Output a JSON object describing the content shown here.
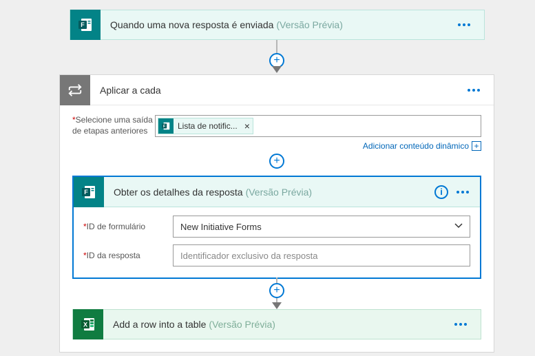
{
  "trigger": {
    "title": "Quando uma nova resposta é enviada",
    "preview": "(Versão Prévia)"
  },
  "foreach": {
    "title": "Aplicar a cada",
    "field_label": "Selecione uma saída de etapas anteriores",
    "token_label": "Lista de notific...",
    "dyn_link": "Adicionar conteúdo dinâmico"
  },
  "step": {
    "title": "Obter os detalhes da resposta",
    "preview": "(Versão Prévia)",
    "form_id_label": "ID de formulário",
    "form_id_value": "New Initiative Forms",
    "response_id_label": "ID da resposta",
    "response_id_placeholder": "Identificador exclusivo da resposta"
  },
  "excel": {
    "title": "Add a row into a table",
    "preview": "(Versão Prévia)"
  }
}
